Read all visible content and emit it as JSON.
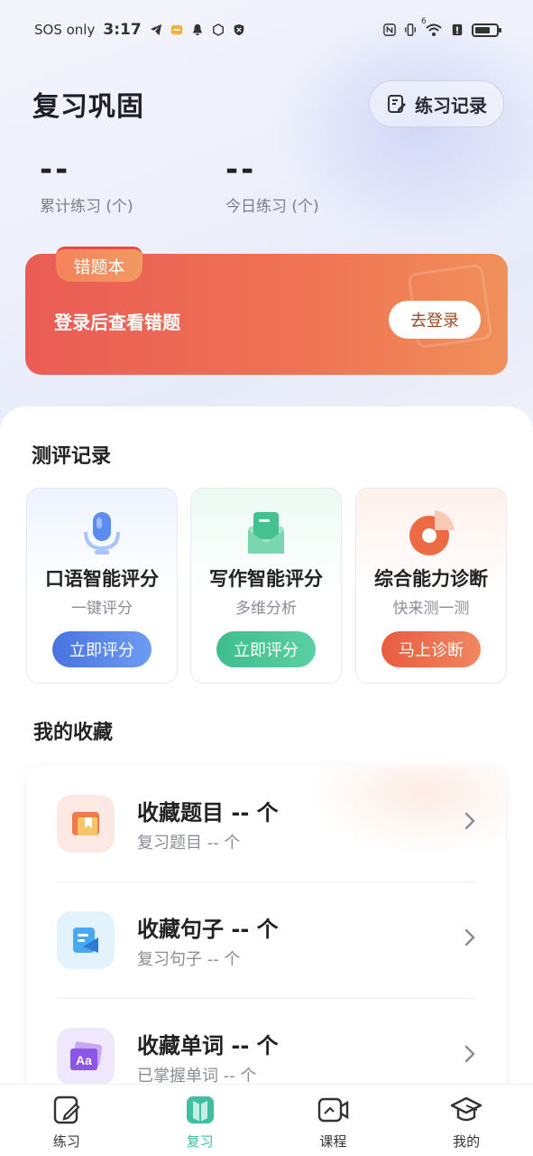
{
  "status_bar": {
    "carrier": "SOS only",
    "time": "3:17",
    "network_badge": "6"
  },
  "header": {
    "title": "复习巩固",
    "record_button": "练习记录"
  },
  "stats": [
    {
      "value": "--",
      "label": "累计练习 (个)"
    },
    {
      "value": "--",
      "label": "今日练习 (个)"
    }
  ],
  "banner": {
    "tag": "错题本",
    "text": "登录后查看错题",
    "button": "去登录"
  },
  "eval_section": {
    "title": "测评记录",
    "cards": [
      {
        "title": "口语智能评分",
        "sub": "一键评分",
        "button": "立即评分",
        "icon": "microphone-icon",
        "color": "#4f7fe8"
      },
      {
        "title": "写作智能评分",
        "sub": "多维分析",
        "button": "立即评分",
        "icon": "envelope-icon",
        "color": "#4ec59b"
      },
      {
        "title": "综合能力诊断",
        "sub": "快来测一测",
        "button": "马上诊断",
        "icon": "pie-chart-icon",
        "color": "#ea6a4a"
      }
    ]
  },
  "fav_section": {
    "title": "我的收藏",
    "items": [
      {
        "title": "收藏题目 -- 个",
        "sub": "复习题目 -- 个",
        "icon": "bookmark-icon"
      },
      {
        "title": "收藏句子 -- 个",
        "sub": "复习句子 -- 个",
        "icon": "sentence-icon"
      },
      {
        "title": "收藏单词 -- 个",
        "sub": "已掌握单词 -- 个",
        "icon": "word-icon"
      }
    ],
    "word_icon_text": "Aa"
  },
  "bottom_nav": [
    {
      "label": "练习",
      "icon": "edit-icon",
      "active": false
    },
    {
      "label": "复习",
      "icon": "book-icon",
      "active": true
    },
    {
      "label": "课程",
      "icon": "video-icon",
      "active": false
    },
    {
      "label": "我的",
      "icon": "graduation-cap-icon",
      "active": false
    }
  ],
  "colors": {
    "accent": "#3fbfa0",
    "banner_start": "#ea5c55",
    "banner_end": "#f0905a"
  }
}
